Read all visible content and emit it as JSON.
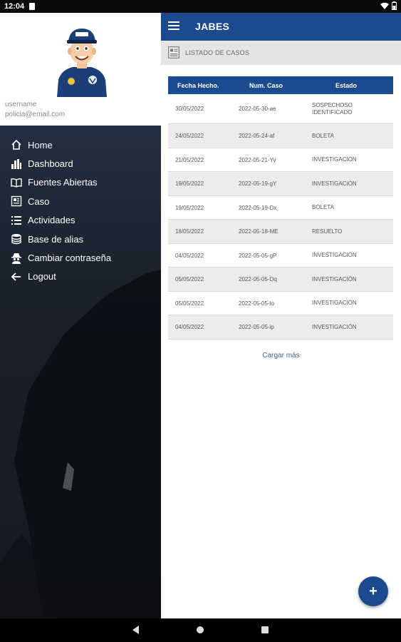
{
  "status_bar": {
    "time": "12:04",
    "icons": [
      "sim-icon",
      "wifi-icon",
      "battery-icon"
    ]
  },
  "drawer": {
    "username": "username",
    "email": "policia@email.com",
    "avatar": "police-officer-avatar",
    "menu": [
      {
        "label": "Home",
        "icon": "home-icon"
      },
      {
        "label": "Dashboard",
        "icon": "dashboard-icon"
      },
      {
        "label": "Fuentes Abiertas",
        "icon": "book-icon"
      },
      {
        "label": "Caso",
        "icon": "case-icon"
      },
      {
        "label": "Actividades",
        "icon": "list-icon"
      },
      {
        "label": "Base de alias",
        "icon": "database-icon"
      },
      {
        "label": "Cambiar contraseña",
        "icon": "user-secret-icon"
      },
      {
        "label": "Logout",
        "icon": "arrow-left-icon"
      }
    ]
  },
  "app_bar": {
    "title": "JABES"
  },
  "section": {
    "title": "LISTADO DE CASOS"
  },
  "table": {
    "headers": [
      "Fecha Hecho.",
      "Num. Caso",
      "Estado"
    ],
    "rows": [
      {
        "fecha": "30/05/2022",
        "caso": "2022-05-30-ae",
        "estado": "SOSPECHOSO IDENTIFICADO"
      },
      {
        "fecha": "24/05/2022",
        "caso": "2022-05-24-af",
        "estado": "BOLETA"
      },
      {
        "fecha": "21/05/2022",
        "caso": "2022-05-21-Yv",
        "estado": "INVESTIGACIÓN"
      },
      {
        "fecha": "19/05/2022",
        "caso": "2022-05-19-gY",
        "estado": "INVESTIGACIÓN"
      },
      {
        "fecha": "19/05/2022",
        "caso": "2022-05-19-Dx",
        "estado": "BOLETA"
      },
      {
        "fecha": "18/05/2022",
        "caso": "2022-05-18-ME",
        "estado": "RESUELTO"
      },
      {
        "fecha": "04/05/2022",
        "caso": "2022-05-05-gP",
        "estado": "INVESTIGACIÓN"
      },
      {
        "fecha": "05/05/2022",
        "caso": "2022-05-05-Dq",
        "estado": "INVESTIGACIÓN"
      },
      {
        "fecha": "05/05/2022",
        "caso": "2022-05-05-to",
        "estado": "INVESTIGACIÓN"
      },
      {
        "fecha": "04/05/2022",
        "caso": "2022-05-05-ip",
        "estado": "INVESTIGACIÓN"
      }
    ]
  },
  "load_more": "Cargar más",
  "fab": {
    "label": "+",
    "icon": "plus-icon"
  },
  "colors": {
    "primary": "#1b4a8f",
    "section_bg": "#e4e4e4",
    "row_alt": "#ececec"
  }
}
